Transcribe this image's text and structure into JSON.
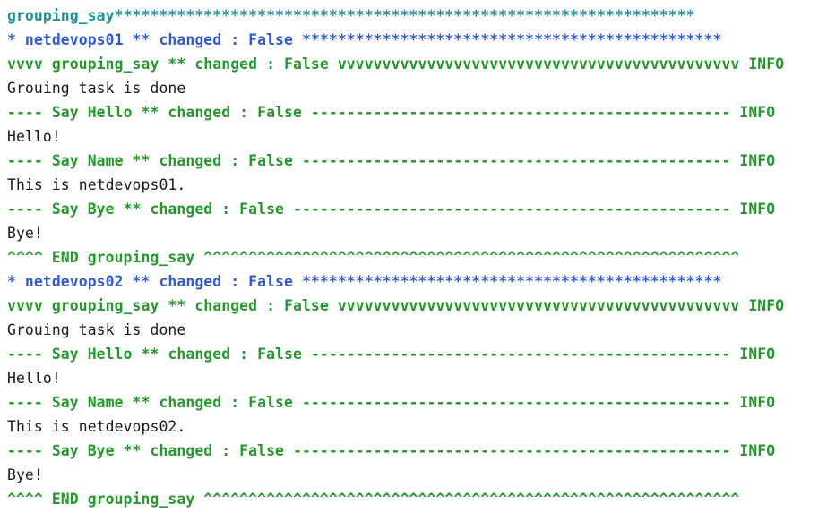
{
  "console": {
    "lines": [
      {
        "text": "grouping_say*****************************************************************",
        "style": "teal"
      },
      {
        "text": "* netdevops01 ** changed : False ***********************************************",
        "style": "blue"
      },
      {
        "text": "vvvv grouping_say ** changed : False vvvvvvvvvvvvvvvvvvvvvvvvvvvvvvvvvvvvvvvvvvvvv INFO",
        "style": "green"
      },
      {
        "text": "Grouing task is done",
        "style": "plain"
      },
      {
        "text": "---- Say Hello ** changed : False ----------------------------------------------- INFO",
        "style": "green"
      },
      {
        "text": "Hello!",
        "style": "plain"
      },
      {
        "text": "---- Say Name ** changed : False ------------------------------------------------ INFO",
        "style": "green"
      },
      {
        "text": "This is netdevops01.",
        "style": "plain"
      },
      {
        "text": "---- Say Bye ** changed : False ------------------------------------------------- INFO",
        "style": "green"
      },
      {
        "text": "Bye!",
        "style": "plain"
      },
      {
        "text": "^^^^ END grouping_say ^^^^^^^^^^^^^^^^^^^^^^^^^^^^^^^^^^^^^^^^^^^^^^^^^^^^^^^^^^^^",
        "style": "green"
      },
      {
        "text": "* netdevops02 ** changed : False ***********************************************",
        "style": "blue"
      },
      {
        "text": "vvvv grouping_say ** changed : False vvvvvvvvvvvvvvvvvvvvvvvvvvvvvvvvvvvvvvvvvvvvv INFO",
        "style": "green"
      },
      {
        "text": "Grouing task is done",
        "style": "plain"
      },
      {
        "text": "---- Say Hello ** changed : False ----------------------------------------------- INFO",
        "style": "green"
      },
      {
        "text": "Hello!",
        "style": "plain"
      },
      {
        "text": "---- Say Name ** changed : False ------------------------------------------------ INFO",
        "style": "green"
      },
      {
        "text": "This is netdevops02.",
        "style": "plain"
      },
      {
        "text": "---- Say Bye ** changed : False ------------------------------------------------- INFO",
        "style": "green"
      },
      {
        "text": "Bye!",
        "style": "plain"
      },
      {
        "text": "^^^^ END grouping_say ^^^^^^^^^^^^^^^^^^^^^^^^^^^^^^^^^^^^^^^^^^^^^^^^^^^^^^^^^^^^",
        "style": "green"
      }
    ]
  },
  "colors": {
    "teal": "#1d8f9f",
    "blue": "#2f59d6",
    "green": "#23982b",
    "plain": "#1a1a1a",
    "background": "#ffffff"
  }
}
